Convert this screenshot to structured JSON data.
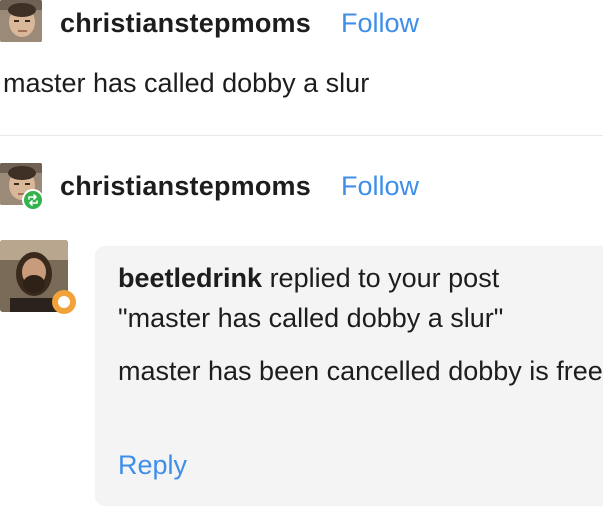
{
  "post1": {
    "username": "christianstepmoms",
    "follow_label": "Follow",
    "text": "master has called dobby a slur"
  },
  "post2": {
    "username": "christianstepmoms",
    "follow_label": "Follow",
    "badge_icon": "reblog-icon",
    "badge_color": "#34b24e"
  },
  "ask": {
    "asker": "beetledrink",
    "replied_text": "replied to your post",
    "quoted_post": "\"master has called dobby a slur\"",
    "reply_text": "master has been cancelled dobby is free",
    "reply_label": "Reply",
    "badge_color": "#f2a23a"
  },
  "colors": {
    "link": "#3f8ee8",
    "card_bg": "#f4f4f4",
    "text": "#1d1d1d"
  }
}
